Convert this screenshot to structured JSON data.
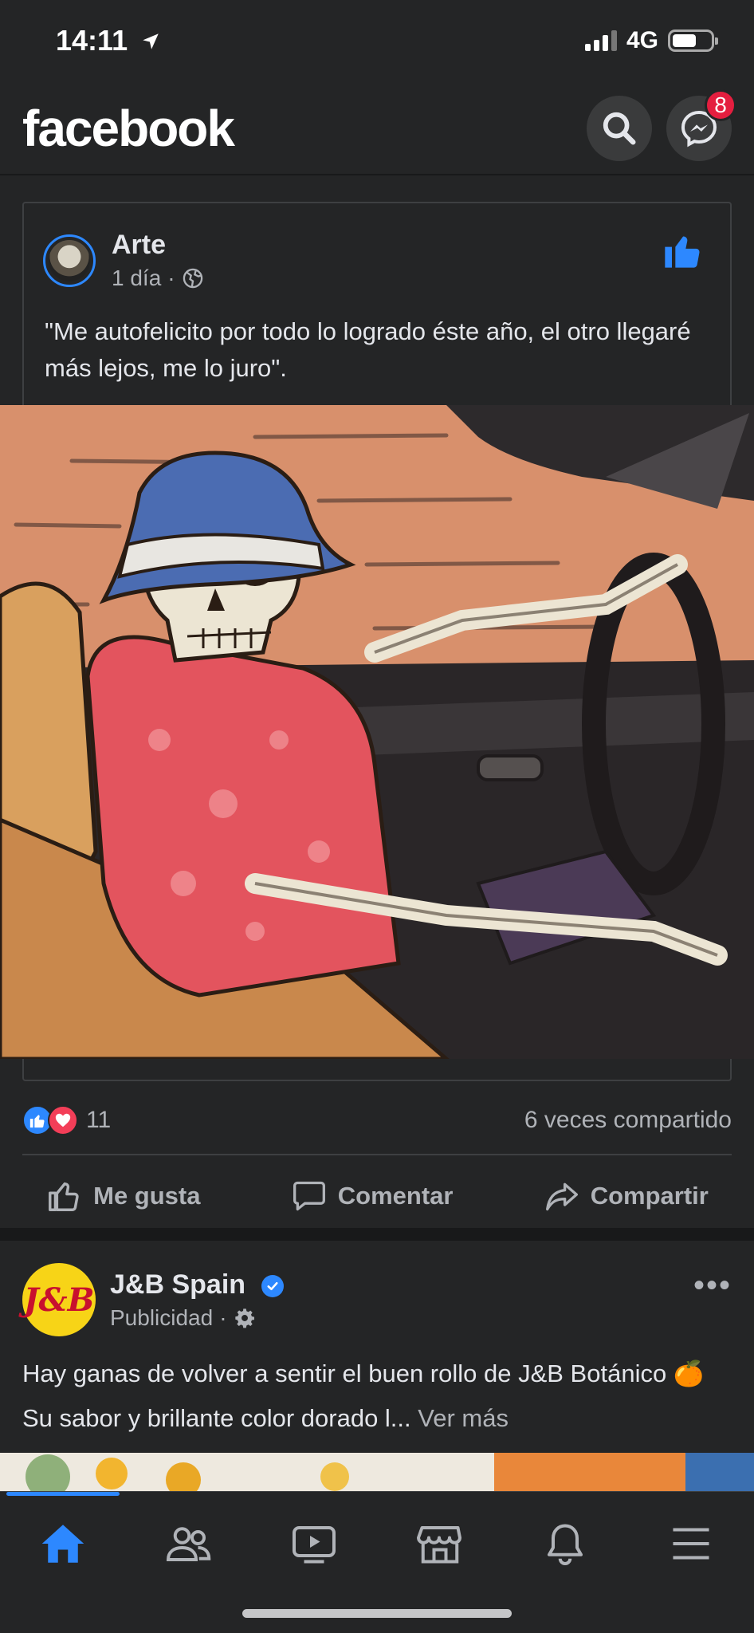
{
  "status": {
    "time": "14:11",
    "network": "4G"
  },
  "header": {
    "logo": "facebook",
    "messenger_badge": "8"
  },
  "post": {
    "author": "Arte",
    "time": "1 día",
    "separator": "·",
    "text": "\"Me autofelicito por todo lo logrado éste año, el otro llegaré más lejos, me lo juro\".",
    "reaction_count": "11",
    "shares": "6 veces compartido"
  },
  "actions": {
    "like": "Me gusta",
    "comment": "Comentar",
    "share": "Compartir"
  },
  "ad": {
    "avatar_text": "J&B",
    "name": "J&B Spain",
    "label": "Publicidad",
    "separator": "·",
    "text": "Hay ganas de volver a sentir el buen rollo de J&B Botánico 🍊 Su sabor y brillante color dorado l...",
    "see_more": "Ver más",
    "more": "•••"
  },
  "colors": {
    "accent": "#2d88ff",
    "background": "#242526",
    "badge": "#e41e3f"
  }
}
